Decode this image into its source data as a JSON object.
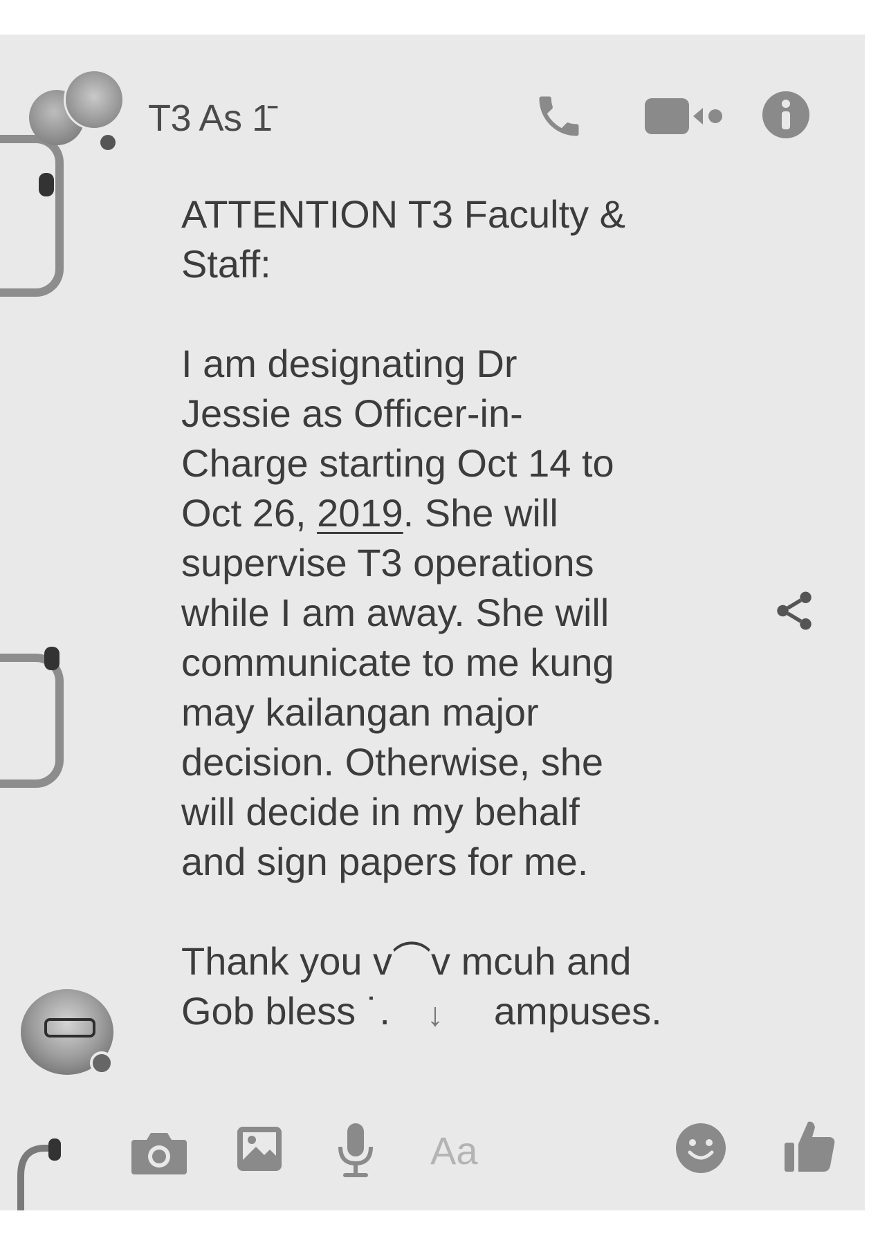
{
  "header": {
    "title": "T3 As 1̄",
    "icons": [
      "phone-icon",
      "video-camera-icon",
      "info-icon"
    ]
  },
  "message": {
    "heading_lines": [
      "ATTENTION T3 Faculty &",
      "Staff:"
    ],
    "body_lines": [
      "I am designating Dr",
      "Jessie as Officer-in-",
      "Charge starting Oct 14 to"
    ],
    "line4_pre": "Oct 26, ",
    "line4_underlined": "2019",
    "line4_post": ". She will",
    "body_lines_2": [
      "supervise T3 operations",
      "while I am away. She will",
      "communicate to me kung",
      "may kailangan major",
      "decision. Otherwise, she",
      "will decide in my behalf",
      "and sign papers for me."
    ],
    "closing_line1": "Thank you v⌒v mcuh and",
    "closing_line2_pre": "Gob bless ˙.",
    "closing_line2_post": "ampuses."
  },
  "scroll_indicator": "↓",
  "composer": {
    "placeholder": "Aa",
    "icons": [
      "camera-icon",
      "image-icon",
      "microphone-icon",
      "emoji-icon",
      "like-icon"
    ]
  },
  "colors": {
    "paper": "#e9e9e9",
    "icon": "#8a8a8a",
    "text": "#3c3c3c"
  }
}
